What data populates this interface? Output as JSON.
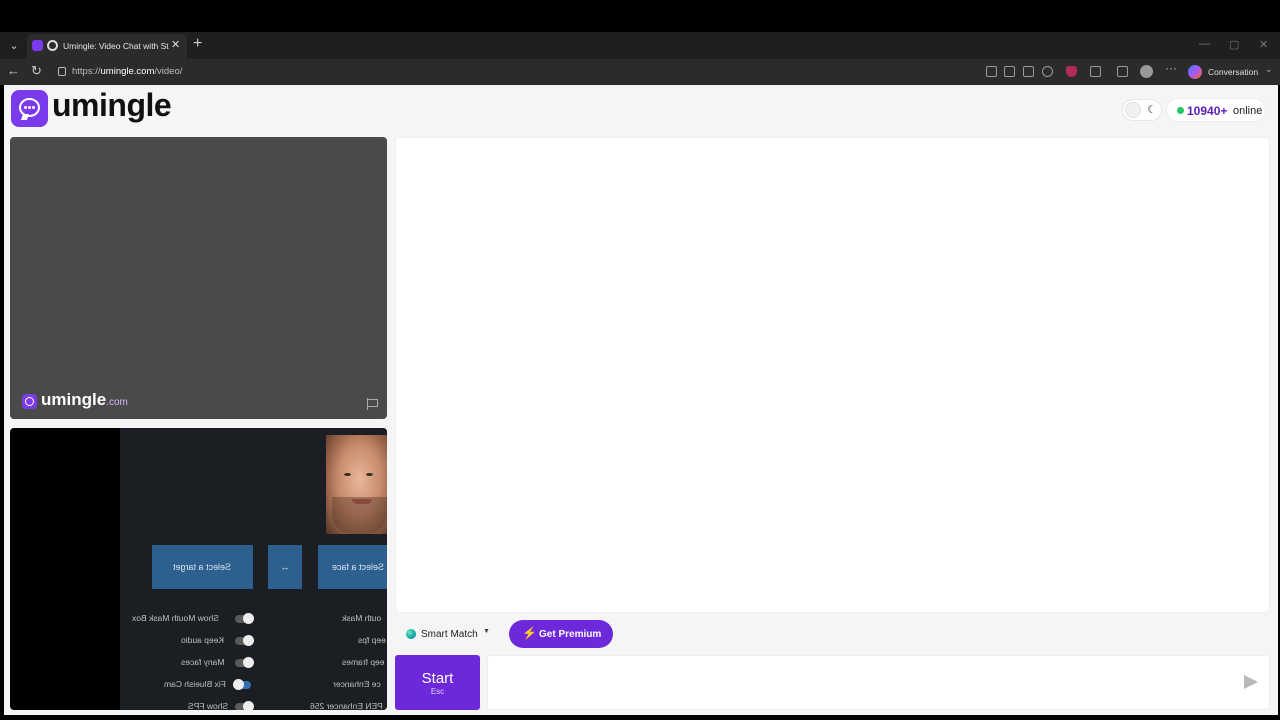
{
  "browser": {
    "tab_title": "Umingle: Video Chat with Strangers",
    "tab_close": "✕",
    "new_tab": "+",
    "url_prefix": "https://",
    "url_domain": "umingle.com",
    "url_path": "/video/",
    "copilot_label": "Conversation",
    "icons": [
      "back-arrow-icon",
      "reload-icon",
      "lock-icon",
      "camera-icon",
      "translate-icon",
      "reader-icon",
      "star-icon",
      "shield-extension-icon",
      "extensions-icon",
      "favorites-icon",
      "more-icon",
      "profile-avatar-icon",
      "copilot-icon"
    ]
  },
  "header": {
    "logo_text": "umingle",
    "online_count": "10940+",
    "online_label": "online"
  },
  "remote_video": {
    "watermark_brand": "umingle",
    "watermark_domain": ".com"
  },
  "local_video": {
    "buttons": {
      "select_target": "Select a target",
      "swap": "↔",
      "select_face": "Select a face"
    },
    "options_left": [
      {
        "label": "Show Mouth Mask Box",
        "on": false
      },
      {
        "label": "Keep audio",
        "on": false
      },
      {
        "label": "Many faces",
        "on": false
      },
      {
        "label": "Fix Blueish Cam",
        "on": true
      },
      {
        "label": "Show FPS",
        "on": false
      }
    ],
    "options_right": [
      "outh Mask",
      "eep fps",
      "eep frames",
      "ce Enhancer",
      "PEN Enhancer 256"
    ]
  },
  "controls": {
    "smart_match_label": "Smart Match",
    "premium_label": "Get Premium",
    "start_label": "Start",
    "start_shortcut": "Esc",
    "message_value": ""
  },
  "colors": {
    "brand": "#7c3aed",
    "premium": "#6d28d9",
    "online_dot": "#22c55e",
    "online_count": "#5b21b6"
  }
}
